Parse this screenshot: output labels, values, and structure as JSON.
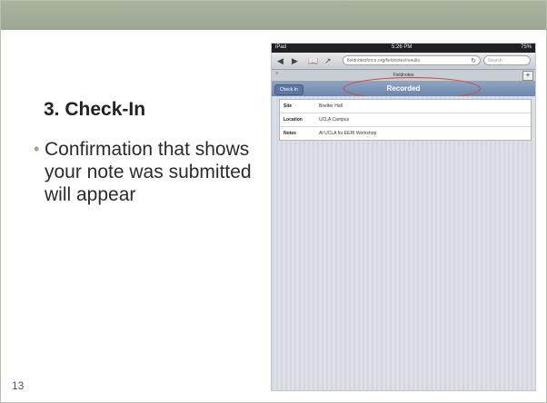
{
  "slide": {
    "title": "3. Check-In",
    "bullet_text": "Confirmation that shows your note was submitted will appear",
    "page_number": "13"
  },
  "ipad": {
    "status": {
      "carrier": "iPad",
      "time": "5:26 PM",
      "battery": "75%"
    },
    "toolbar": {
      "back_glyph": "◀",
      "forward_glyph": "▶",
      "bookmarks_glyph": "📖",
      "share_glyph": "↗",
      "url": "fieldnotesforce.org/fieldnotes/results",
      "search_placeholder": "Search"
    },
    "tab": {
      "label": "Fieldnotes",
      "close_glyph": "×",
      "add_glyph": "+"
    },
    "navbar": {
      "back_label": "Check In",
      "title": "Recorded"
    },
    "details": [
      {
        "label": "Site",
        "value": "Boelter Hall"
      },
      {
        "label": "Location",
        "value": "UCLA Campus"
      },
      {
        "label": "Notes",
        "value": "At UCLA for EERI Workshop"
      }
    ]
  },
  "colors": {
    "highlight": "#d0433a",
    "navbar": "#6d86ab",
    "slide_bar": "#9ca895"
  }
}
